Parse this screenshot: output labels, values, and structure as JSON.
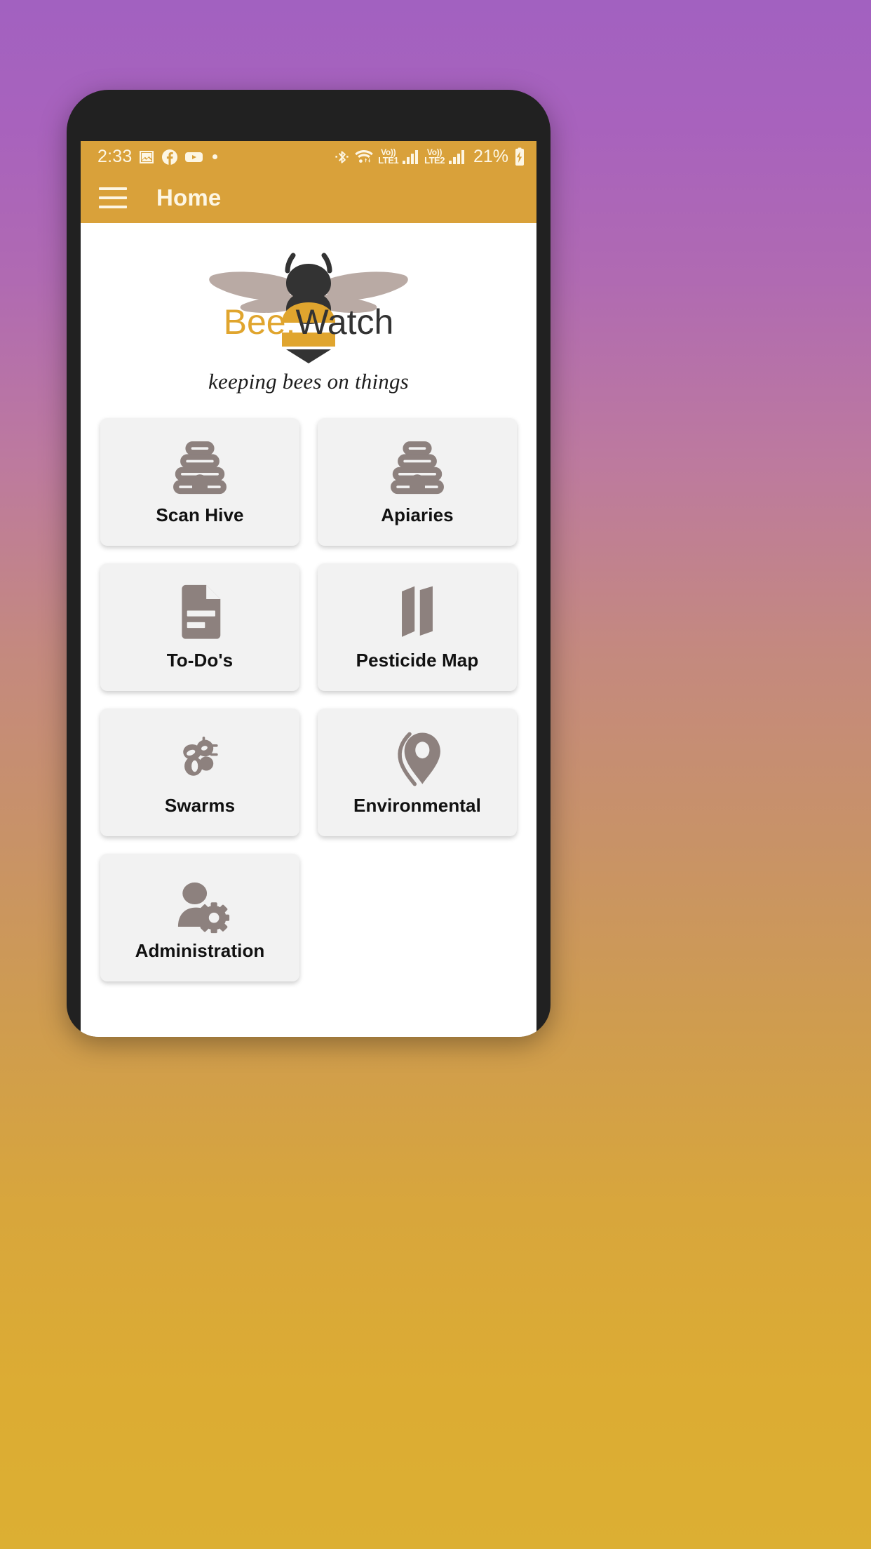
{
  "device": {
    "status_bar": {
      "time": "2:33",
      "left_icons": [
        "image-icon",
        "facebook-icon",
        "youtube-icon",
        "notification-dot"
      ],
      "bluetooth": "bluetooth-icon",
      "wifi": "wifi-icon",
      "sims": [
        {
          "volte_label": "Vo))",
          "network_label": "LTE1",
          "signal_icon": "signal-bars-icon"
        },
        {
          "volte_label": "Vo))",
          "network_label": "LTE2",
          "signal_icon": "signal-bars-icon"
        }
      ],
      "battery_percent": "21%",
      "battery_icon": "battery-charging-icon"
    }
  },
  "app_bar": {
    "menu_icon": "hamburger-menu-icon",
    "title": "Home"
  },
  "branding": {
    "logo_icon": "bee-logo-icon",
    "name_part_1": "Bee.",
    "name_part_2": "Watch",
    "tagline": "keeping bees on things"
  },
  "home_grid": {
    "tiles": [
      {
        "label": "Scan Hive",
        "icon": "beehive-icon"
      },
      {
        "label": "Apiaries",
        "icon": "beehive-icon"
      },
      {
        "label": "To-Do's",
        "icon": "document-icon"
      },
      {
        "label": "Pesticide Map",
        "icon": "folded-map-icon"
      },
      {
        "label": "Swarms",
        "icon": "bee-swarm-icon"
      },
      {
        "label": "Environmental",
        "icon": "map-pin-icon"
      },
      {
        "label": "Administration",
        "icon": "user-settings-icon"
      }
    ]
  },
  "colors": {
    "accent_amber": "#d9a13a",
    "logo_gold": "#e0a52e",
    "logo_dark": "#333333",
    "wing_taupe": "#b9aaa4",
    "icon_gray": "#8d817e",
    "tile_bg": "#f2f2f2",
    "status_text": "#fdf6e4",
    "bg_gradient_top": "#a261c0",
    "bg_gradient_bottom": "#dcaf33"
  }
}
